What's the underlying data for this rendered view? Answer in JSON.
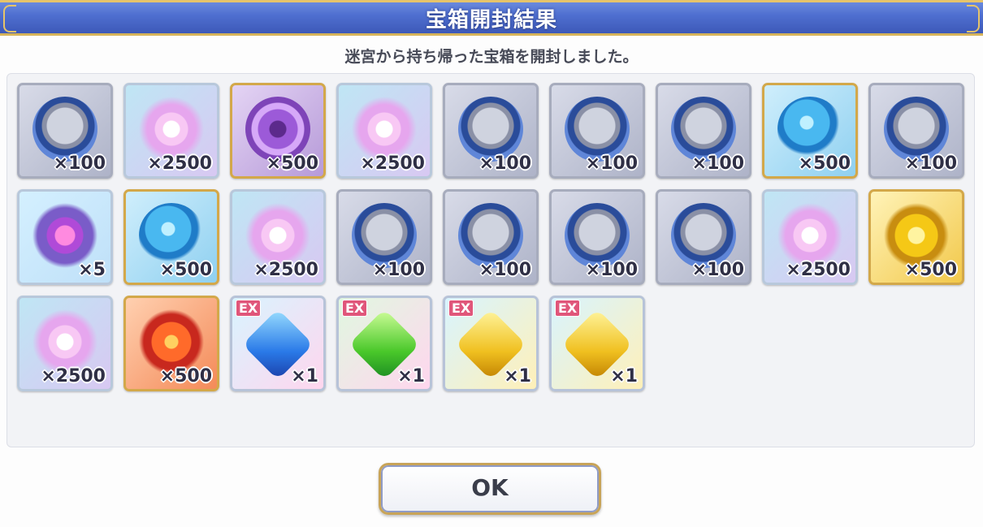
{
  "dialog": {
    "title": "宝箱開封結果",
    "message": "迷宮から持ち帰った宝箱を開封しました。",
    "ok_label": "OK"
  },
  "items": [
    {
      "type": "medal",
      "quantity": "×100"
    },
    {
      "type": "pink-star",
      "quantity": "×2500"
    },
    {
      "type": "purple-orb",
      "quantity": "×500"
    },
    {
      "type": "pink-star",
      "quantity": "×2500"
    },
    {
      "type": "medal",
      "quantity": "×100"
    },
    {
      "type": "medal",
      "quantity": "×100"
    },
    {
      "type": "medal",
      "quantity": "×100"
    },
    {
      "type": "blue-orb",
      "quantity": "×500"
    },
    {
      "type": "medal",
      "quantity": "×100"
    },
    {
      "type": "crystal",
      "quantity": "×5"
    },
    {
      "type": "blue-orb",
      "quantity": "×500"
    },
    {
      "type": "pink-star",
      "quantity": "×2500"
    },
    {
      "type": "medal",
      "quantity": "×100"
    },
    {
      "type": "medal",
      "quantity": "×100"
    },
    {
      "type": "medal",
      "quantity": "×100"
    },
    {
      "type": "medal",
      "quantity": "×100"
    },
    {
      "type": "pink-star",
      "quantity": "×2500"
    },
    {
      "type": "gold-orb",
      "quantity": "×500"
    },
    {
      "type": "pink-star",
      "quantity": "×2500"
    },
    {
      "type": "red-orb",
      "quantity": "×500"
    },
    {
      "type": "ex-blue",
      "badge": "EX",
      "quantity": "×1"
    },
    {
      "type": "ex-green",
      "badge": "EX",
      "quantity": "×1"
    },
    {
      "type": "ex-gold",
      "badge": "EX",
      "quantity": "×1"
    },
    {
      "type": "ex-gold",
      "badge": "EX",
      "quantity": "×1"
    }
  ]
}
